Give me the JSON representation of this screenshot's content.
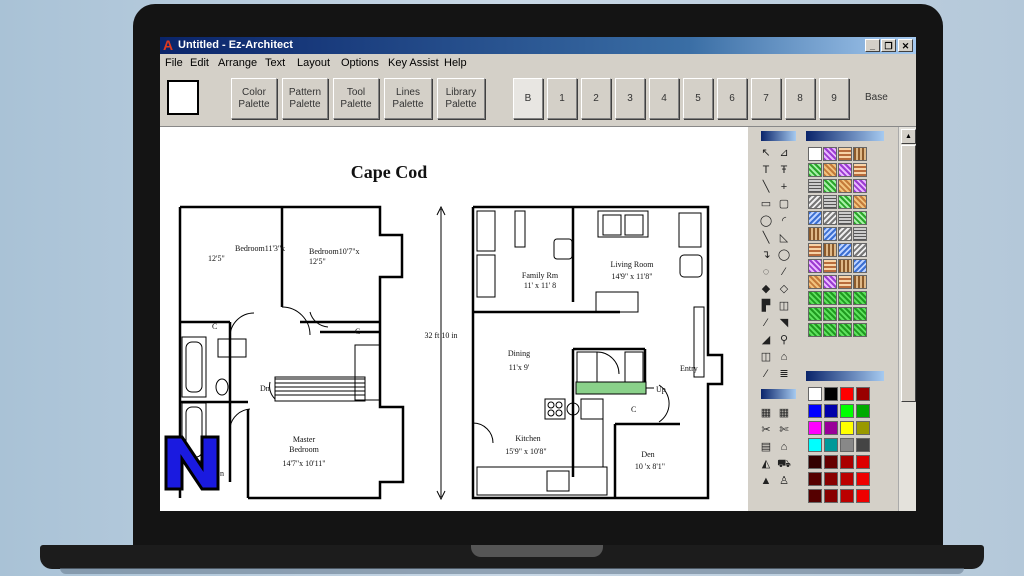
{
  "window": {
    "title": "Untitled - Ez-Architect",
    "min": "_",
    "restore": "❐",
    "close": "✕"
  },
  "menu": [
    "File",
    "Edit",
    "Arrange",
    "Text",
    "Layout",
    "Options",
    "Key Assist",
    "Help"
  ],
  "toolbar": {
    "palettes": [
      "Color\nPalette",
      "Pattern\nPalette",
      "Tool\nPalette",
      "Lines\nPalette",
      "Library\nPalette"
    ],
    "layers": [
      "B",
      "1",
      "2",
      "3",
      "4",
      "5",
      "6",
      "7",
      "8",
      "9"
    ],
    "base_label": "Base"
  },
  "drawing": {
    "title": "Cape Cod",
    "dimension": "32 ft 10 in",
    "rooms": {
      "bedroom1": {
        "name": "Bedroom11'3\"x",
        "size": "12'5\""
      },
      "bedroom2": {
        "name": "Bedroom10'7\"x",
        "size": "12'5\""
      },
      "master": {
        "name1": "Master",
        "name2": "Bedroom",
        "size": "14'7\"x 10'11\""
      },
      "family": {
        "name": "Family Rm",
        "size": "11' x 11' 8"
      },
      "living": {
        "name": "Living Room",
        "size": "14'9\" x 11'8\""
      },
      "dining": {
        "name": "Dining",
        "size": "11'x 9'"
      },
      "kitchen": {
        "name": "Kitchen",
        "size": "15'9\" x 10'8\""
      },
      "den": {
        "name": "Den",
        "size": "10 'x 8'1\""
      }
    },
    "labels": {
      "closet": "C",
      "down": "Dn",
      "up": "Up",
      "entry": "Entry",
      "n": "n"
    }
  },
  "tools": [
    "↖",
    "⊿",
    "T",
    "Ŧ",
    "╲",
    "+",
    "▭",
    "▢",
    "◯",
    "◜",
    "╲",
    "◺",
    "↴",
    "◯",
    "◌",
    "⁄",
    "◆",
    "◇",
    "▛",
    "◫",
    "⁄",
    "◥",
    "◢",
    "⚲",
    "◫",
    "⌂",
    "⁄",
    "≣"
  ],
  "tools2": [
    "▦",
    "▦",
    "✂",
    "✄",
    "▤",
    "⌂",
    "◭",
    "⛟",
    "▲",
    "♙"
  ],
  "colors": {
    "accent": "#0a246a",
    "grid": [
      "#ffffff",
      "#000000",
      "#ff0000",
      "#990000",
      "#0000ff",
      "#0000aa",
      "#00ff00",
      "#00aa00",
      "#ff00ff",
      "#990099",
      "#ffff00",
      "#999900",
      "#00ffff",
      "#009999",
      "#888888",
      "#444444",
      "#330000",
      "#660000",
      "#aa0000",
      "#dd0000"
    ]
  }
}
